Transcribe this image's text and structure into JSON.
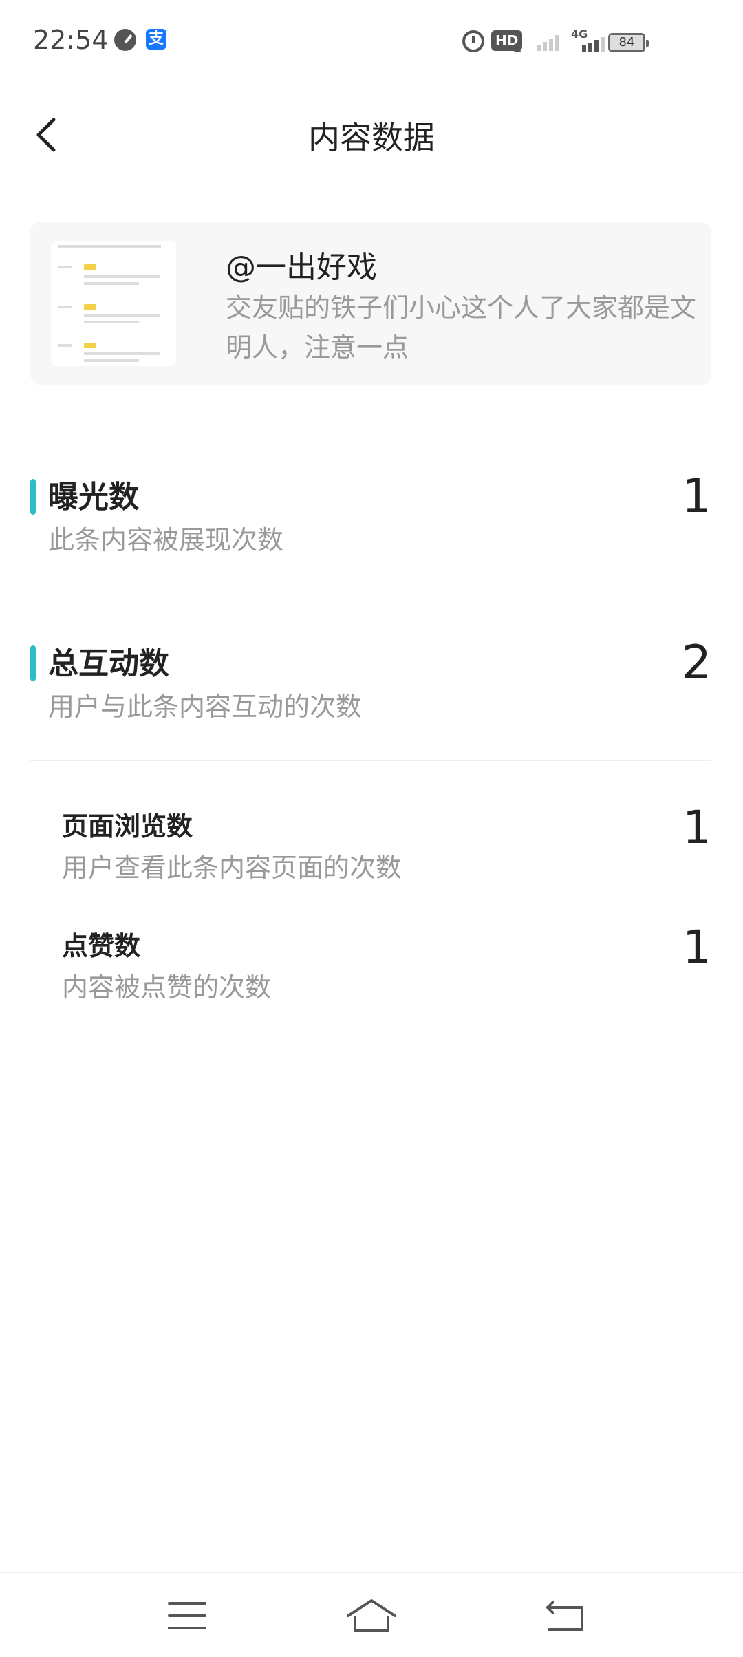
{
  "status_bar": {
    "time": "22:54",
    "alipay_glyph": "支",
    "hd_label": "HD",
    "hd_sub": "2",
    "network": "4G",
    "battery": "84",
    "icons": [
      "speedometer-icon",
      "alipay-icon",
      "alarm-icon",
      "hd-icon",
      "signal-icon",
      "signal-4g-icon",
      "battery-icon"
    ]
  },
  "header": {
    "title": "内容数据",
    "back_icon": "chevron-left-icon"
  },
  "content_card": {
    "author": "@一出好戏",
    "text": "交友贴的铁子们小心这个人了大家都是文明人，注意一点"
  },
  "metrics": [
    {
      "title": "曝光数",
      "desc": "此条内容被展现次数",
      "value": "1"
    },
    {
      "title": "总互动数",
      "desc": "用户与此条内容互动的次数",
      "value": "2"
    }
  ],
  "sub_metrics": [
    {
      "title": "页面浏览数",
      "desc": "用户查看此条内容页面的次数",
      "value": "1"
    },
    {
      "title": "点赞数",
      "desc": "内容被点赞的次数",
      "value": "1"
    }
  ],
  "nav_bar": {
    "icons": [
      "menu-icon",
      "home-icon",
      "back-icon"
    ]
  },
  "colors": {
    "accent": "#2fbcc6",
    "secondary_text": "#999999",
    "card_bg": "#f7f7f7"
  }
}
